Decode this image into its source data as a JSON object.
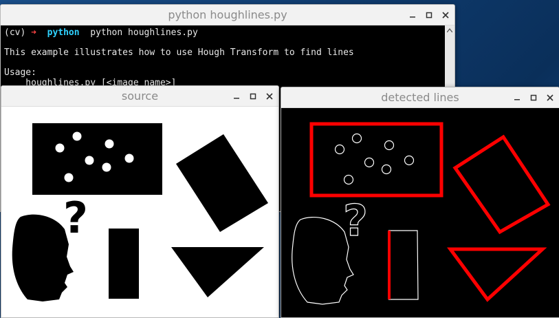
{
  "terminal": {
    "title": "python houghlines.py",
    "prompt_env": "(cv)",
    "prompt_arrow": "➜",
    "prompt_dir": "python",
    "command": "python houghlines.py",
    "line1": "This example illustrates how to use Hough Transform to find lines",
    "line2": "Usage:",
    "line3": "    houghlines.py [<image name>]"
  },
  "source_window": {
    "title": "source"
  },
  "detected_window": {
    "title": "detected lines"
  },
  "window_controls": {
    "minimize": "minimize-icon",
    "maximize": "maximize-icon",
    "close": "close-icon"
  },
  "colors": {
    "line_color": "#ff0000",
    "desktop": "#0f3b6e"
  },
  "question_mark": "?"
}
